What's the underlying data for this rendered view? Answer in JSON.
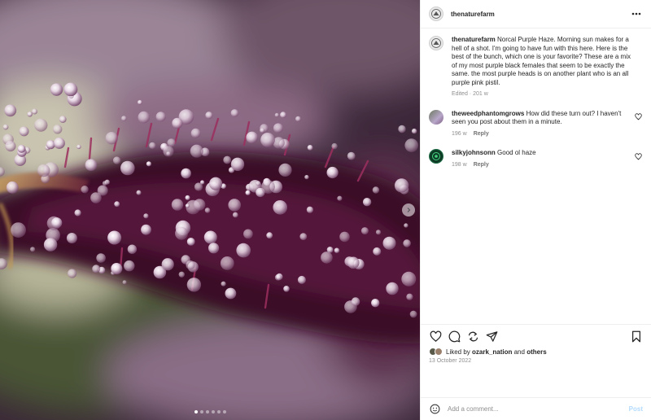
{
  "post": {
    "username": "thenaturefarm",
    "carousel": {
      "count": 6,
      "active_index": 0
    }
  },
  "caption": {
    "username": "thenaturefarm",
    "text": "Norcal Purple Haze. Morning sun makes for a hell of a shot. I'm going to have fun with this here. Here is the best of the bunch, which one is your favorite? These are a mix of my most purple black females that seem to be exactly the same. the most purple heads is on another plant who is an all purple pink pistil.",
    "meta": "Edited · 201 w"
  },
  "comments": [
    {
      "username": "theweedphantomgrows",
      "text": "How did these turn out? I haven't seen you post about them in a minute.",
      "age": "196 w",
      "reply_label": "Reply"
    },
    {
      "username": "silkyjohnsonn",
      "text": "Good ol haze",
      "age": "198 w",
      "reply_label": "Reply"
    }
  ],
  "likes": {
    "prefix": "Liked by",
    "user": "ozark_nation",
    "joiner": "and",
    "suffix": "others"
  },
  "date": "13 October 2022",
  "add_comment": {
    "placeholder": "Add a comment...",
    "post_label": "Post"
  },
  "icons": {
    "more": "more-horizontal-icon",
    "like": "heart-icon",
    "comment": "comment-bubble-icon",
    "share": "repost-icon",
    "send": "paper-plane-icon",
    "save": "bookmark-icon",
    "emoji": "smiley-icon",
    "next": "chevron-right-icon"
  },
  "colors": {
    "link": "#0095f6",
    "post_disabled": "#b3dbff",
    "muted": "#8e8e8e",
    "text": "#262626"
  }
}
